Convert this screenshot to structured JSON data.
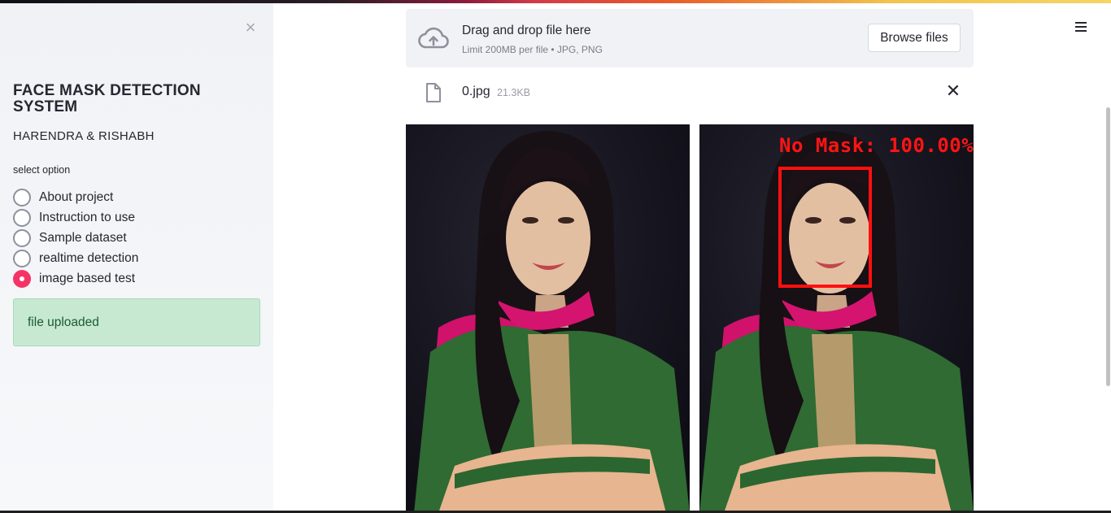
{
  "sidebar": {
    "close_glyph": "×",
    "title": "FACE MASK DETECTION SYSTEM",
    "authors": "HARENDRA & RISHABH",
    "radio_label": "select option",
    "options": [
      {
        "label": "About project",
        "selected": false
      },
      {
        "label": "Instruction to use",
        "selected": false
      },
      {
        "label": "Sample dataset",
        "selected": false
      },
      {
        "label": "realtime detection",
        "selected": false
      },
      {
        "label": "image based test",
        "selected": true
      }
    ],
    "status_message": "file uploaded"
  },
  "uploader": {
    "title": "Drag and drop file here",
    "limit": "Limit 200MB per file • JPG, PNG",
    "browse_label": "Browse files",
    "icon": "cloud-upload-icon"
  },
  "file": {
    "name": "0.jpg",
    "size": "21.3KB",
    "remove_glyph": "✕",
    "icon": "file-icon"
  },
  "result": {
    "label": "No Mask: 100.00%"
  },
  "colors": {
    "accent": "#f63366",
    "success_bg": "#c7e9d2",
    "success_text": "#1a5b31",
    "sidebar_bg": "#f0f2f6",
    "detection_box": "#ff1010"
  }
}
